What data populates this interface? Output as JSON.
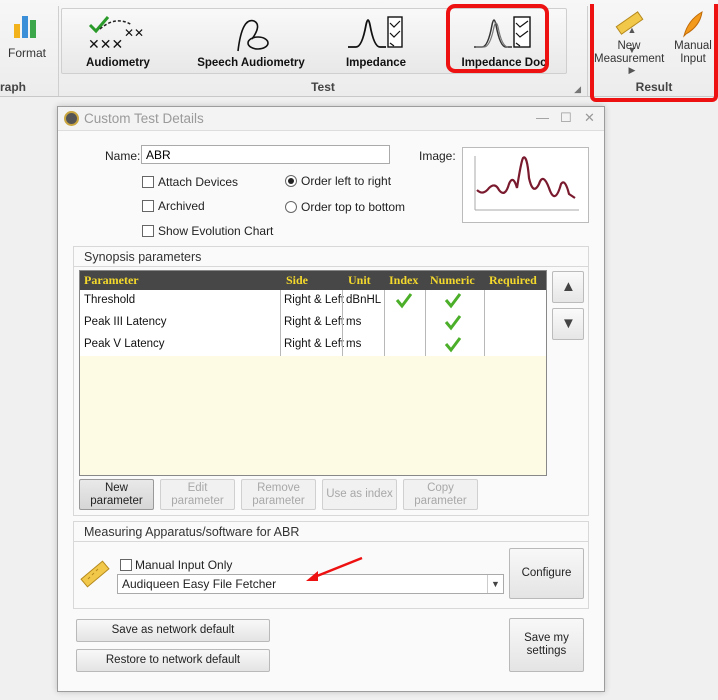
{
  "ribbon": {
    "format_label": "Format",
    "graph_group_label": "raph",
    "test_group_label": "Test",
    "test_items": [
      "Audiometry",
      "Speech Audiometry",
      "Impedance",
      "Impedance Doc"
    ],
    "result_group_label": "Result",
    "new_measurement_line1": "New",
    "new_measurement_line2": "Measurement",
    "manual_input_line1": "Manual",
    "manual_input_line2": "Input"
  },
  "dialog": {
    "title": "Custom Test Details",
    "name_label": "Name:",
    "name_value": "ABR",
    "image_label": "Image:",
    "attach_devices": "Attach Devices",
    "archived": "Archived",
    "show_evolution_chart": "Show Evolution Chart",
    "order_left_right": "Order left to right",
    "order_top_bottom": "Order top to bottom",
    "synopsis_title": "Synopsis parameters",
    "grid_headers": [
      "Parameter",
      "Side",
      "Unit",
      "Index",
      "Numeric",
      "Required"
    ],
    "rows": [
      {
        "parameter": "Threshold",
        "side": "Right & Left",
        "unit": "dBnHL",
        "index": true,
        "numeric": true,
        "required": false
      },
      {
        "parameter": "Peak III Latency",
        "side": "Right & Left",
        "unit": "ms",
        "index": false,
        "numeric": true,
        "required": false
      },
      {
        "parameter": "Peak V Latency",
        "side": "Right & Left",
        "unit": "ms",
        "index": false,
        "numeric": true,
        "required": false
      }
    ],
    "btn_new_1": "New",
    "btn_new_2": "parameter",
    "btn_edit_1": "Edit",
    "btn_edit_2": "parameter",
    "btn_remove_1": "Remove",
    "btn_remove_2": "parameter",
    "btn_use_index": "Use as index",
    "btn_copy_1": "Copy",
    "btn_copy_2": "parameter",
    "apparatus_title": "Measuring Apparatus/software for ABR",
    "manual_input_only": "Manual Input Only",
    "apparatus_selected": "Audiqueen Easy File Fetcher",
    "configure": "Configure",
    "save_network_default": "Save as network default",
    "restore_network_default": "Restore to network default",
    "save_my_1": "Save my",
    "save_my_2": "settings"
  },
  "colors": {
    "highlight": "#e11111",
    "grid_header_bg": "#474747",
    "grid_header_text": "#f4d92c",
    "grid_empty_bg": "#fdfbe3",
    "check_green": "#4caf2a"
  }
}
